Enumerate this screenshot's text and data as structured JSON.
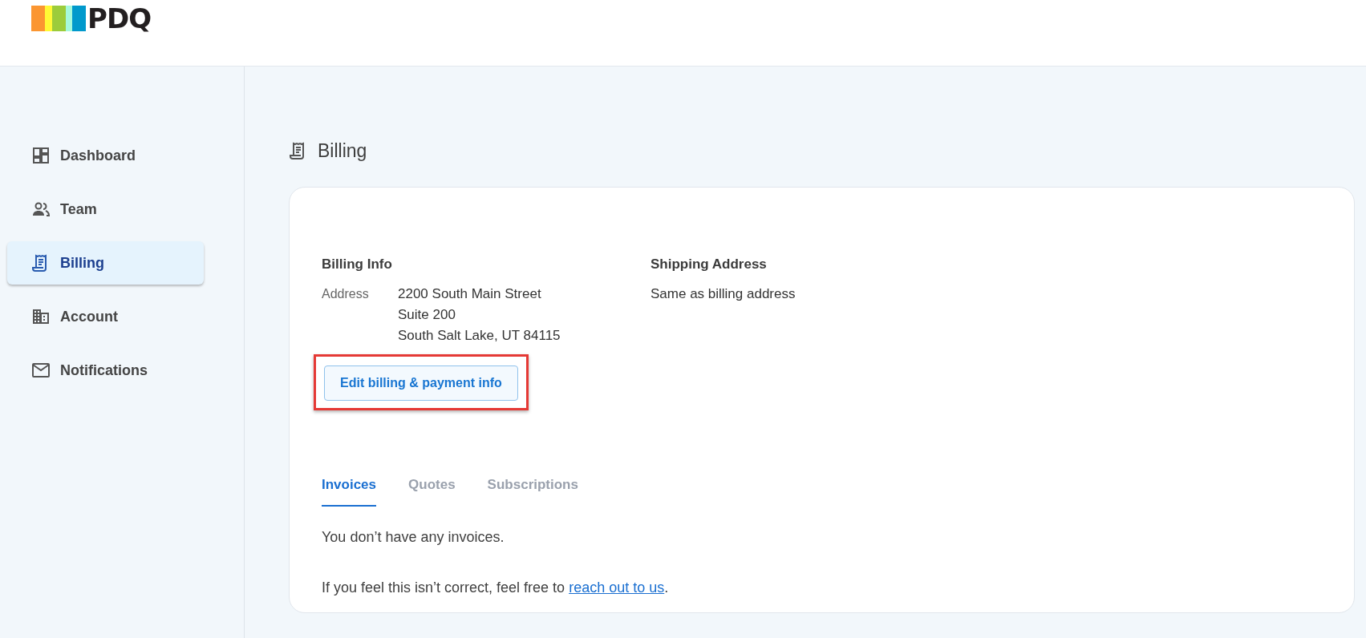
{
  "header": {
    "logo_text": "PDQ"
  },
  "sidebar": {
    "items": [
      {
        "label": "Dashboard",
        "kind": "dashboard",
        "selected": false
      },
      {
        "label": "Team",
        "kind": "team",
        "selected": false
      },
      {
        "label": "Billing",
        "kind": "billing",
        "selected": true
      },
      {
        "label": "Account",
        "kind": "account",
        "selected": false
      },
      {
        "label": "Notifications",
        "kind": "mail",
        "selected": false
      }
    ]
  },
  "page": {
    "title": "Billing"
  },
  "billing_info": {
    "heading": "Billing Info",
    "address_label": "Address",
    "address_lines": [
      "2200 South Main Street",
      "Suite 200",
      "South Salt Lake, UT 84115"
    ],
    "edit_button": {
      "label": "Edit billing & payment info",
      "highlighted": true
    }
  },
  "shipping": {
    "heading": "Shipping Address",
    "text": "Same as billing address"
  },
  "tabs": [
    {
      "label": "Invoices",
      "selected": true
    },
    {
      "label": "Quotes",
      "selected": false
    },
    {
      "label": "Subscriptions",
      "selected": false
    }
  ],
  "empty_message": "You don’t have any invoices.",
  "help": {
    "before": "If you feel this isn’t correct, feel free to ",
    "link": "reach out to us",
    "after": "."
  }
}
